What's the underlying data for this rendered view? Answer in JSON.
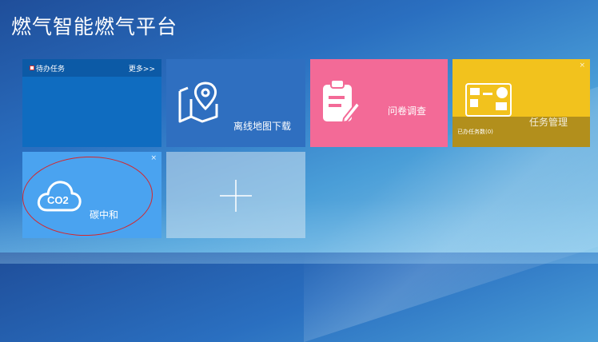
{
  "header": {
    "title": "燃气智能燃气平台"
  },
  "tiles": {
    "todo": {
      "label": "待办任务",
      "more": "更多>>"
    },
    "map": {
      "label": "离线地图下载",
      "icon": "map-pin-icon"
    },
    "survey": {
      "label": "问卷调查",
      "icon": "clipboard-edit-icon"
    },
    "task": {
      "label": "任务管理",
      "count_text": "已办任务数(0)",
      "close": "×",
      "icon": "task-board-icon"
    },
    "carbon": {
      "label": "碳中和",
      "close": "×",
      "icon": "co2-cloud-icon",
      "icon_text": "CO2"
    },
    "add": {
      "icon": "plus-icon"
    }
  },
  "colors": {
    "todo": "#0f6cc0",
    "map": "#2f6fc0",
    "survey": "#f36a97",
    "task": "#f2c21d",
    "carbon": "#4aa3f0",
    "annotation": "#d6262a"
  }
}
